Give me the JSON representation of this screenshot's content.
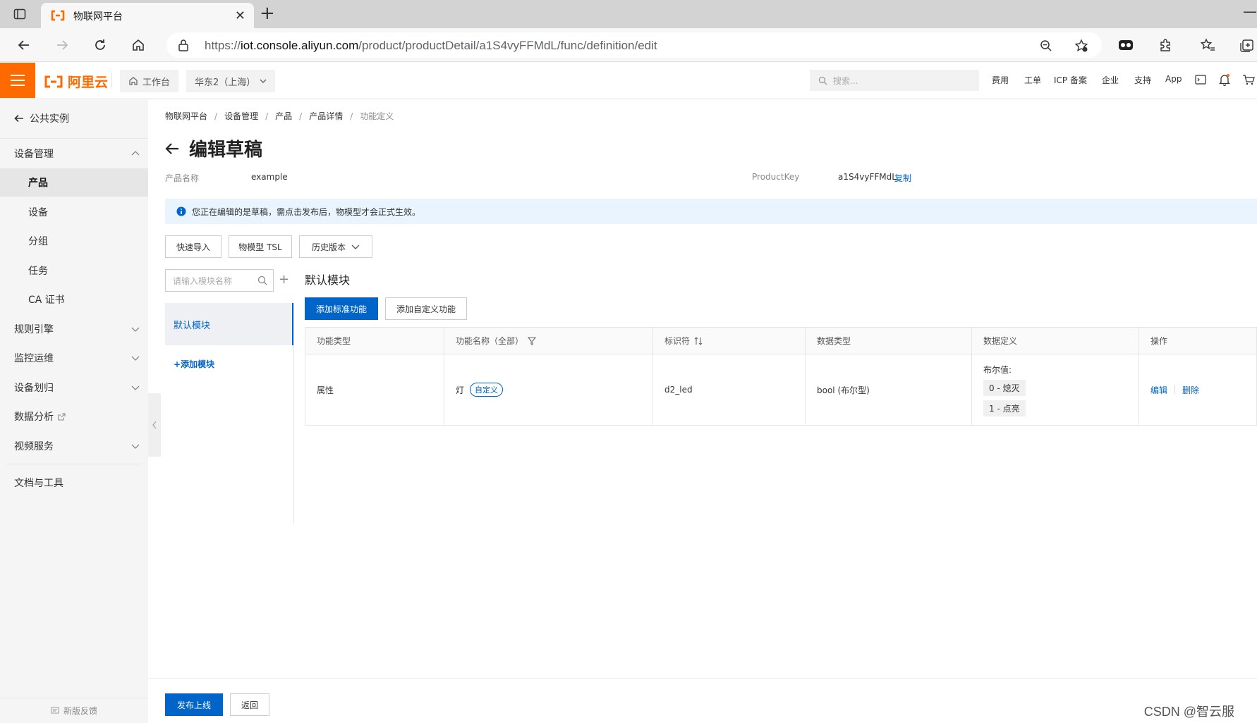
{
  "browser": {
    "tab_title": "物联网平台",
    "url_prefix": "https://",
    "url_host": "iot.console.aliyun.com",
    "url_path": "/product/productDetail/a1S4vyFFMdL/func/definition/edit"
  },
  "topnav": {
    "logo_text": "阿里云",
    "workbench": "工作台",
    "region": "华东2（上海）",
    "search_placeholder": "搜索...",
    "links": [
      "费用",
      "工单",
      "ICP 备案",
      "企业",
      "支持",
      "App"
    ]
  },
  "sidebar": {
    "back_label": "公共实例",
    "items": [
      {
        "label": "设备管理"
      },
      {
        "label": "产品"
      },
      {
        "label": "设备"
      },
      {
        "label": "分组"
      },
      {
        "label": "任务"
      },
      {
        "label": "CA 证书"
      },
      {
        "label": "规则引擎"
      },
      {
        "label": "监控运维"
      },
      {
        "label": "设备划归"
      },
      {
        "label": "数据分析"
      },
      {
        "label": "视频服务"
      },
      {
        "label": "文档与工具"
      }
    ],
    "feedback": "新版反馈"
  },
  "breadcrumb": [
    "物联网平台",
    "设备管理",
    "产品",
    "产品详情",
    "功能定义"
  ],
  "page": {
    "title": "编辑草稿",
    "product_name_label": "产品名称",
    "product_name": "example",
    "product_key_label": "ProductKey",
    "product_key": "a1S4vyFFMdL",
    "copy_label": "复制",
    "notice": "您正在编辑的是草稿，需点击发布后，物模型才会正式生效。",
    "quick_import": "快速导入",
    "tsl": "物模型 TSL",
    "history": "历史版本",
    "module_search_placeholder": "请输入模块名称",
    "module_default": "默认模块",
    "add_module": "+添加模块",
    "section_title": "默认模块",
    "add_std": "添加标准功能",
    "add_custom": "添加自定义功能",
    "publish": "发布上线",
    "back": "返回"
  },
  "table": {
    "headers": [
      "功能类型",
      "功能名称（全部）",
      "标识符",
      "数据类型",
      "数据定义",
      "操作"
    ],
    "rows": [
      {
        "type": "属性",
        "name": "灯",
        "tag": "自定义",
        "identifier": "d2_led",
        "data_type": "bool (布尔型)",
        "def_title": "布尔值:",
        "def_values": [
          "0 - 熄灭",
          "1 - 点亮"
        ],
        "edit": "编辑",
        "delete": "删除"
      }
    ]
  },
  "watermark": "CSDN @智云服",
  "colors": {
    "brand": "#ff6a00",
    "primary": "#0064c8",
    "notice_bg": "#e9f4fe"
  }
}
